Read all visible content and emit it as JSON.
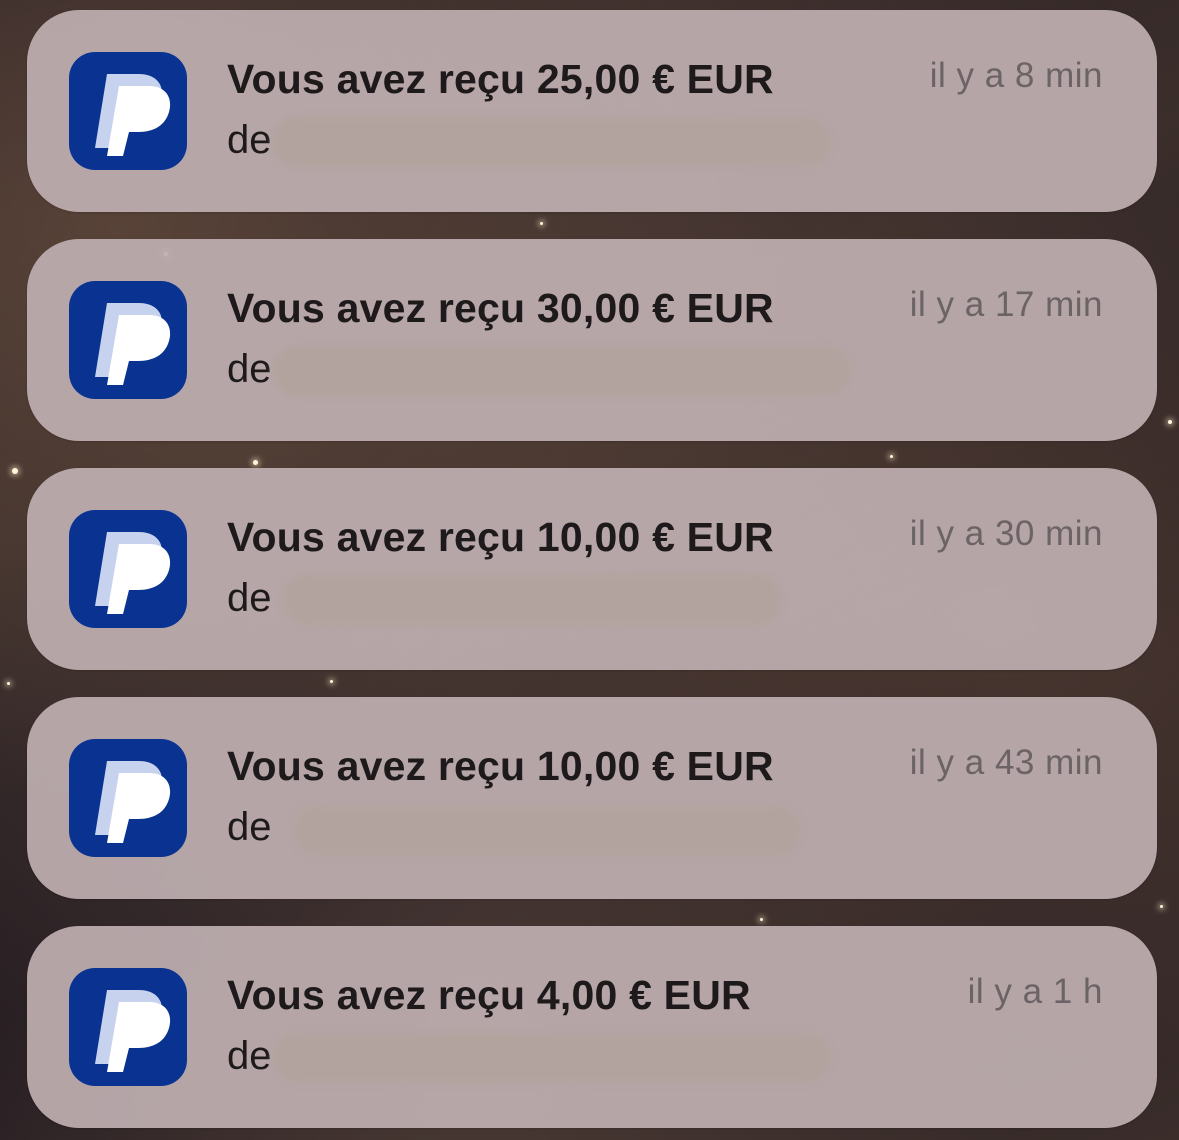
{
  "notifications": [
    {
      "app_icon": "paypal-icon",
      "title": "Vous avez reçu 25,00 € EUR",
      "body_prefix": "de",
      "time": "il y a 8 min"
    },
    {
      "app_icon": "paypal-icon",
      "title": "Vous avez reçu 30,00 € EUR",
      "body_prefix": "de",
      "time": "il y a 17 min"
    },
    {
      "app_icon": "paypal-icon",
      "title": "Vous avez reçu 10,00 € EUR",
      "body_prefix": "de",
      "time": "il y a 30 min"
    },
    {
      "app_icon": "paypal-icon",
      "title": "Vous avez reçu 10,00 € EUR",
      "body_prefix": "de",
      "time": "il y a 43 min"
    },
    {
      "app_icon": "paypal-icon",
      "title": "Vous avez reçu 4,00 € EUR",
      "body_prefix": "de",
      "time": "il y a 1 h"
    }
  ],
  "colors": {
    "paypal_blue": "#0a3391",
    "paypal_light": "#c7d2ef",
    "card_bg": "#beaeb0"
  }
}
